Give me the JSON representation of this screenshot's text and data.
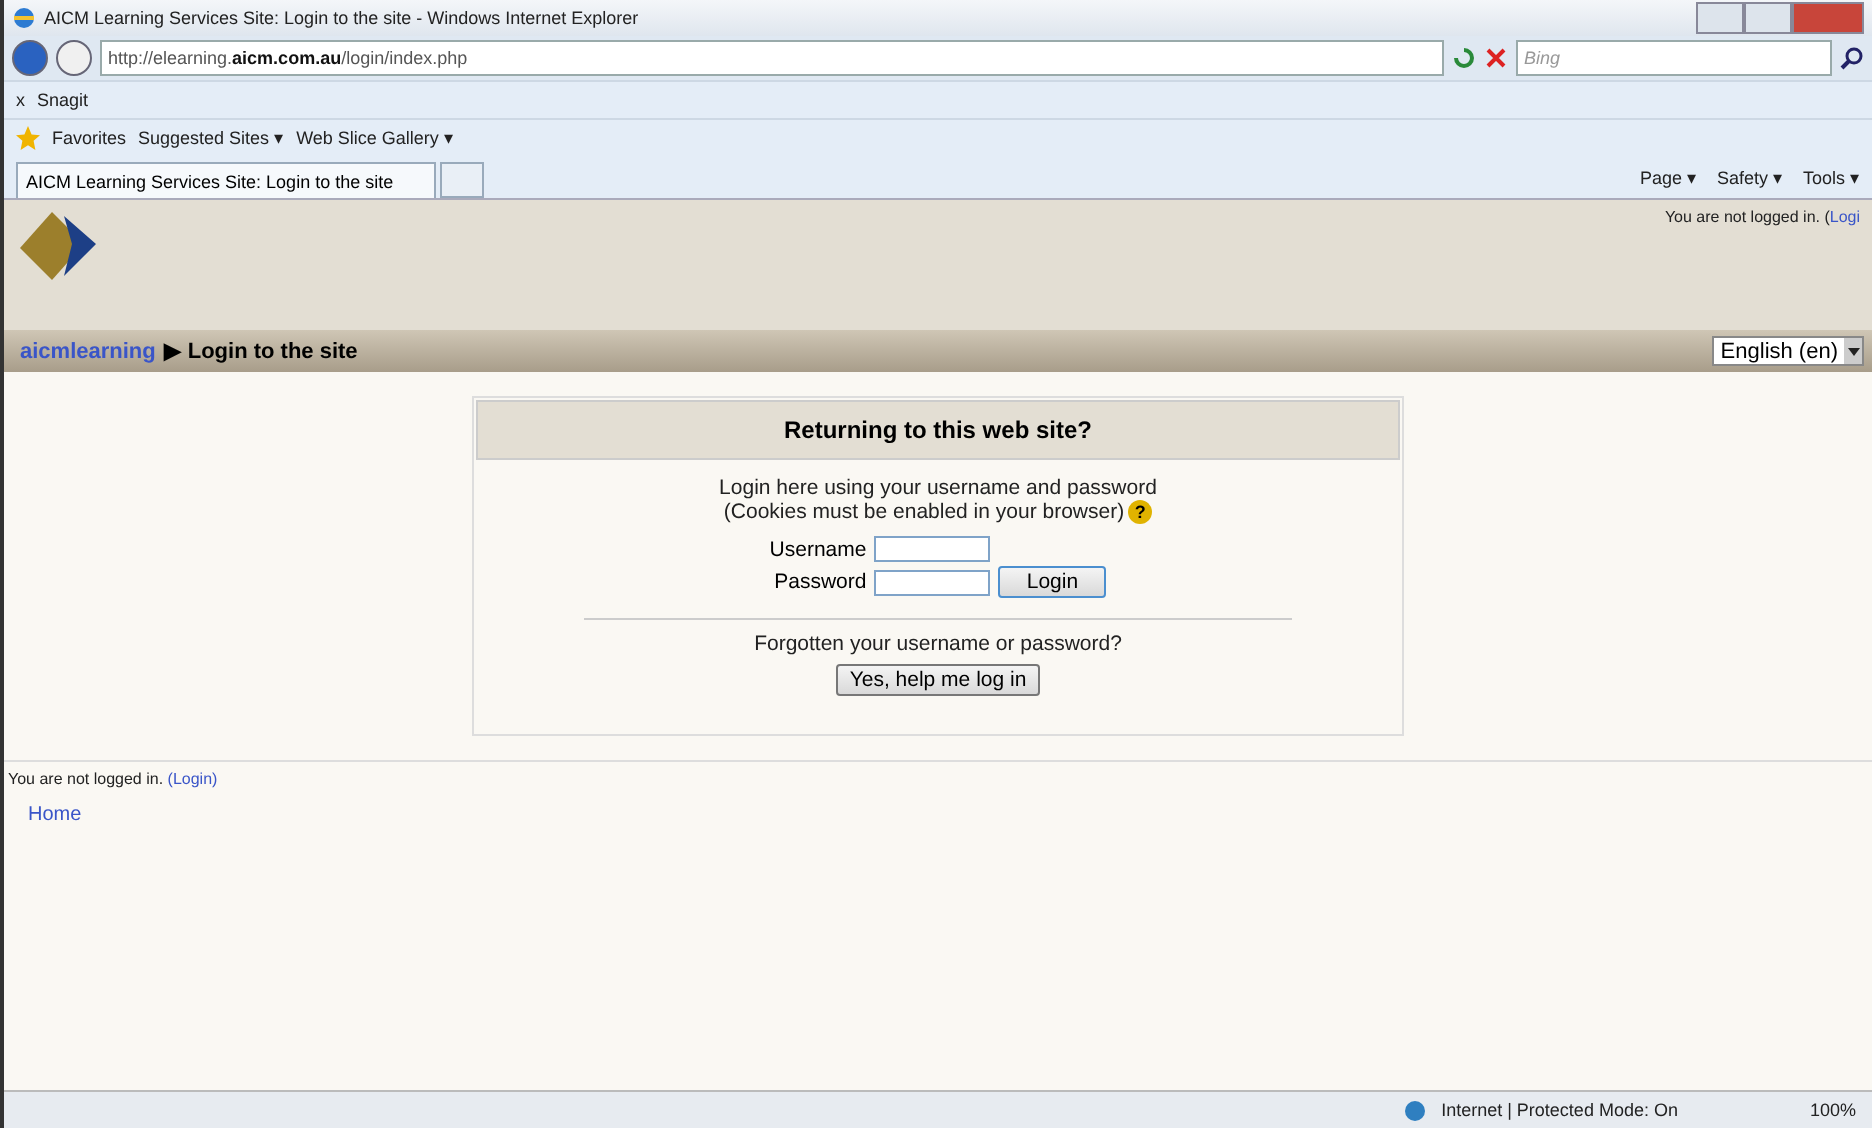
{
  "window": {
    "title": "AICM Learning Services Site: Login to the site - Windows Internet Explorer"
  },
  "address_bar": {
    "url_prefix": "http://elearning.",
    "url_domain": "aicm.com.au",
    "url_path": "/login/index.php",
    "search_placeholder": "Bing"
  },
  "toolbar": {
    "close": "x",
    "items": [
      "Snagit"
    ]
  },
  "favorites_bar": {
    "label": "Favorites",
    "items": [
      "Suggested Sites ▾",
      "Web Slice Gallery ▾"
    ]
  },
  "tabs": [
    {
      "label": "AICM Learning Services Site: Login to the site",
      "selected": true
    }
  ],
  "command_bar": [
    "Page ▾",
    "Safety ▾",
    "Tools ▾"
  ],
  "header": {
    "login_info": "You are not logged in. (",
    "login_link": "Logi"
  },
  "breadcrumb": {
    "home": "aicmlearning",
    "separator": "▶",
    "current": "Login to the site"
  },
  "language": {
    "value": "English (en)"
  },
  "login_box": {
    "title": "Returning to this web site?",
    "intro": "Login here using your username and password",
    "note": "(Cookies must be enabled in your browser)",
    "help": "?",
    "fields": [
      {
        "label": "Username"
      },
      {
        "label": "Password"
      }
    ],
    "login_button": "Login",
    "forgot": "Forgotten your username or password?",
    "help_button": "Yes, help me log in"
  },
  "footer": {
    "login_info": "You are not logged in. ",
    "login_link": "(Login)",
    "home_link": "Home"
  },
  "status_bar": {
    "zone": "Internet | Protected Mode: On",
    "zoom": "100%"
  }
}
